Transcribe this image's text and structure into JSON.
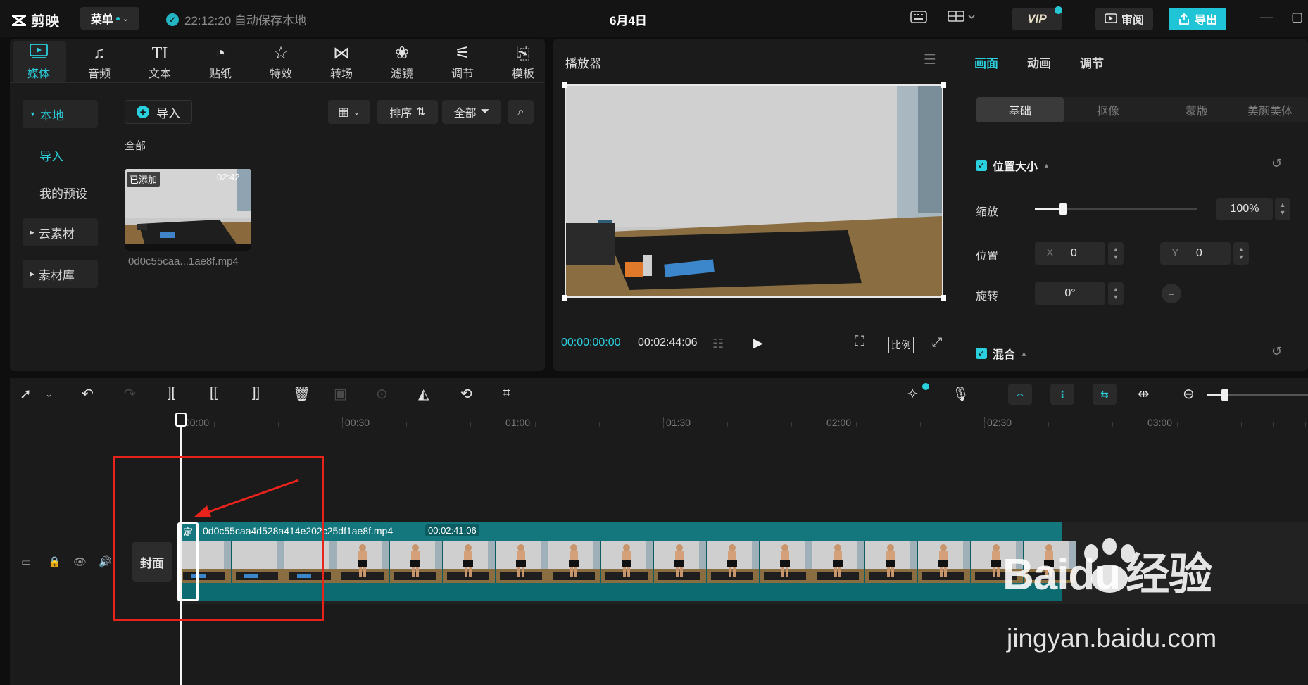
{
  "app": {
    "logo": "剪映",
    "menu_label": "菜单",
    "autosave_text": "22:12:20 自动保存本地",
    "doc_title": "6月4日",
    "vip_label": "VIP",
    "review_label": "审阅",
    "export_label": "导出"
  },
  "media_tabs": [
    {
      "label": "媒体",
      "icon": "media-icon"
    },
    {
      "label": "音频",
      "icon": "audio-icon"
    },
    {
      "label": "文本",
      "icon": "text-icon"
    },
    {
      "label": "贴纸",
      "icon": "sticker-icon"
    },
    {
      "label": "特效",
      "icon": "effects-icon"
    },
    {
      "label": "转场",
      "icon": "transition-icon"
    },
    {
      "label": "滤镜",
      "icon": "filter-icon"
    },
    {
      "label": "调节",
      "icon": "adjust-icon"
    },
    {
      "label": "模板",
      "icon": "template-icon"
    }
  ],
  "side_nav": {
    "local": "本地",
    "import": "导入",
    "my_presets": "我的预设",
    "cloud": "云素材",
    "library": "素材库"
  },
  "media": {
    "import_button": "导入",
    "sort_label": "排序",
    "filter_label": "全部",
    "section_label": "全部",
    "item": {
      "badge": "已添加",
      "duration": "02:42",
      "filename": "0d0c55caa...1ae8f.mp4"
    }
  },
  "player": {
    "title": "播放器",
    "current_time": "00:00:00:00",
    "total_time": "00:02:44:06",
    "ratio_label": "比例"
  },
  "props": {
    "tabs": [
      "画面",
      "动画",
      "调节"
    ],
    "sub_tabs": [
      "基础",
      "抠像",
      "蒙版",
      "美颜美体"
    ],
    "position_size_label": "位置大小",
    "scale_label": "缩放",
    "scale_value": "100%",
    "scale_fraction": 0.1,
    "position_label": "位置",
    "x_label": "X",
    "x_value": "0",
    "y_label": "Y",
    "y_value": "0",
    "rotate_label": "旋转",
    "rotate_value": "0°",
    "blend_label": "混合"
  },
  "timeline": {
    "ruler_labels": [
      "00:00",
      "00:30",
      "01:00",
      "01:30",
      "02:00",
      "02:30",
      "03:00"
    ],
    "cover_label": "封面",
    "clip_fixed": "定",
    "clip_name": "0d0c55caa4d528a414e202c25df1ae8f.mp4",
    "clip_duration": "00:02:41:06",
    "zoom_fraction": 0.18
  },
  "watermark": {
    "brand": "Baidu",
    "suffix": "经验",
    "url": "jingyan.baidu.com"
  }
}
